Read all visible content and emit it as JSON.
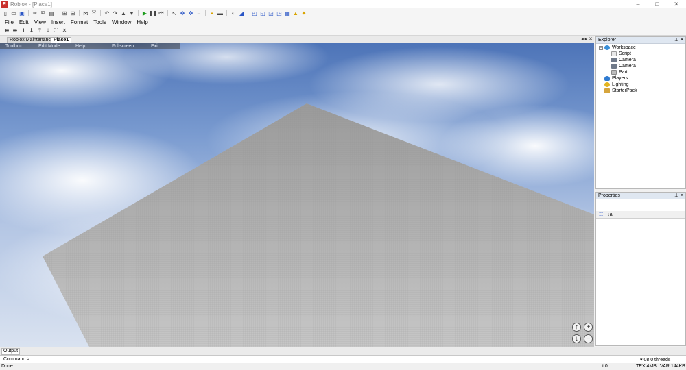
{
  "window": {
    "title": "Roblox - [Place1]",
    "logo": "R"
  },
  "toolbar1": {
    "icons": [
      "new-icon",
      "open-icon",
      "save-icon",
      "cut-icon",
      "copy-icon",
      "paste-icon",
      "undo-icon",
      "redo-icon",
      "group-icon",
      "ungroup-icon",
      "play-icon",
      "pause-icon",
      "stop-icon",
      "reset-icon",
      "select-icon",
      "move-icon",
      "drag-icon",
      "resize-icon",
      "lock-icon",
      "anchor-icon",
      "color-icon",
      "material-icon",
      "surface-icon"
    ]
  },
  "menu": [
    "File",
    "Edit",
    "View",
    "Insert",
    "Format",
    "Tools",
    "Window",
    "Help"
  ],
  "doc_tabs": [
    "Roblox Maintenance",
    "Place1"
  ],
  "overlay": [
    "Toolbox",
    "Edit Mode",
    "Help...",
    "Fullscreen",
    "Exit"
  ],
  "explorer": {
    "title": "Explorer",
    "items": [
      {
        "label": "Workspace",
        "color": "#3a8fd8"
      },
      {
        "label": "Script",
        "color": "#c7c7c7"
      },
      {
        "label": "Camera",
        "color": "#707a8a"
      },
      {
        "label": "Camera",
        "color": "#707a8a"
      },
      {
        "label": "Part",
        "color": "#bdbdbd"
      },
      {
        "label": "Players",
        "color": "#2f7bd1"
      },
      {
        "label": "Lighting",
        "color": "#e3b521"
      },
      {
        "label": "StarterPack",
        "color": "#d6a53d"
      }
    ]
  },
  "properties": {
    "title": "Properties"
  },
  "output": {
    "tab": "Output"
  },
  "command": {
    "label": "Command >",
    "right": "▾ 08  0 threads"
  },
  "status": {
    "left": "Done",
    "t": "t 0",
    "tex": "TEX 4MB",
    "var": "VAR 144KB"
  }
}
